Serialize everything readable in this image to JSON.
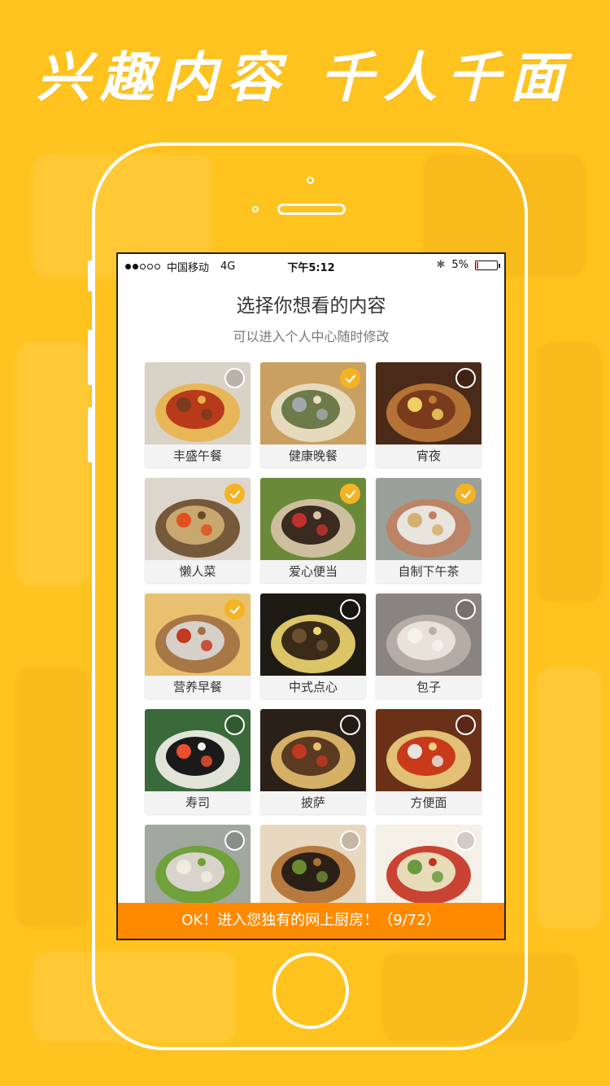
{
  "banner": {
    "left": "兴趣内容",
    "right": "千人千面"
  },
  "status_bar": {
    "carrier": "中国移动",
    "network": "4G",
    "time": "下午5:12",
    "battery_text": "5%",
    "battery_level": 0.05,
    "signal_bars_filled": 2,
    "signal_bars_total": 5
  },
  "header": {
    "title": "选择你想看的内容",
    "subtitle": "可以进入个人中心随时修改"
  },
  "categories": [
    {
      "label": "丰盛午餐",
      "selected": false,
      "photo_colors": [
        "#b83a1a",
        "#e8b24a",
        "#7a3a1f",
        "#d9d2c7"
      ]
    },
    {
      "label": "健康晚餐",
      "selected": true,
      "photo_colors": [
        "#6d7a4a",
        "#e9e0c8",
        "#a0a8ac",
        "#c9a060"
      ]
    },
    {
      "label": "宵夜",
      "selected": false,
      "photo_colors": [
        "#7a3b1c",
        "#c07a3a",
        "#f0d060",
        "#4a2a18"
      ]
    },
    {
      "label": "懒人菜",
      "selected": true,
      "photo_colors": [
        "#c9a870",
        "#6a4a2a",
        "#e05020",
        "#dcd6cc"
      ]
    },
    {
      "label": "爱心便当",
      "selected": true,
      "photo_colors": [
        "#3a2a20",
        "#d8c4a8",
        "#c03030",
        "#6a8a3a"
      ]
    },
    {
      "label": "自制下午茶",
      "selected": true,
      "photo_colors": [
        "#e8e4de",
        "#c08060",
        "#d4b070",
        "#9aa09a"
      ]
    },
    {
      "label": "营养早餐",
      "selected": true,
      "photo_colors": [
        "#d6d0c8",
        "#a07040",
        "#c43a20",
        "#e8c070"
      ]
    },
    {
      "label": "中式点心",
      "selected": false,
      "photo_colors": [
        "#3a2a18",
        "#f0d870",
        "#6a5030",
        "#1e1a14"
      ]
    },
    {
      "label": "包子",
      "selected": false,
      "photo_colors": [
        "#e8e2da",
        "#b8b0a8",
        "#f6f2ee",
        "#8a8480"
      ]
    },
    {
      "label": "寿司",
      "selected": false,
      "photo_colors": [
        "#1a1a1a",
        "#f5f2ec",
        "#e85030",
        "#3a6a3a"
      ]
    },
    {
      "label": "披萨",
      "selected": false,
      "photo_colors": [
        "#5a3a20",
        "#e8c070",
        "#c03820",
        "#2a2018"
      ]
    },
    {
      "label": "方便面",
      "selected": false,
      "photo_colors": [
        "#c83a1a",
        "#f0d080",
        "#e8e4de",
        "#6a3018"
      ]
    },
    {
      "label": "",
      "selected": false,
      "photo_colors": [
        "#d8d4cc",
        "#6aa030",
        "#f0ece0",
        "#a0a8a0"
      ]
    },
    {
      "label": "",
      "selected": false,
      "photo_colors": [
        "#2a2018",
        "#b07030",
        "#6a8a30",
        "#e8d8c0"
      ]
    },
    {
      "label": "",
      "selected": false,
      "photo_colors": [
        "#e8dcb8",
        "#c43020",
        "#6a9a40",
        "#f4f0e8"
      ]
    }
  ],
  "ok_bar": {
    "text": "OK！进入您独有的网上厨房！（9/72）"
  },
  "colors": {
    "background": "#ffc31f",
    "accent": "#ff8a00",
    "check_on": "#f5b324"
  }
}
